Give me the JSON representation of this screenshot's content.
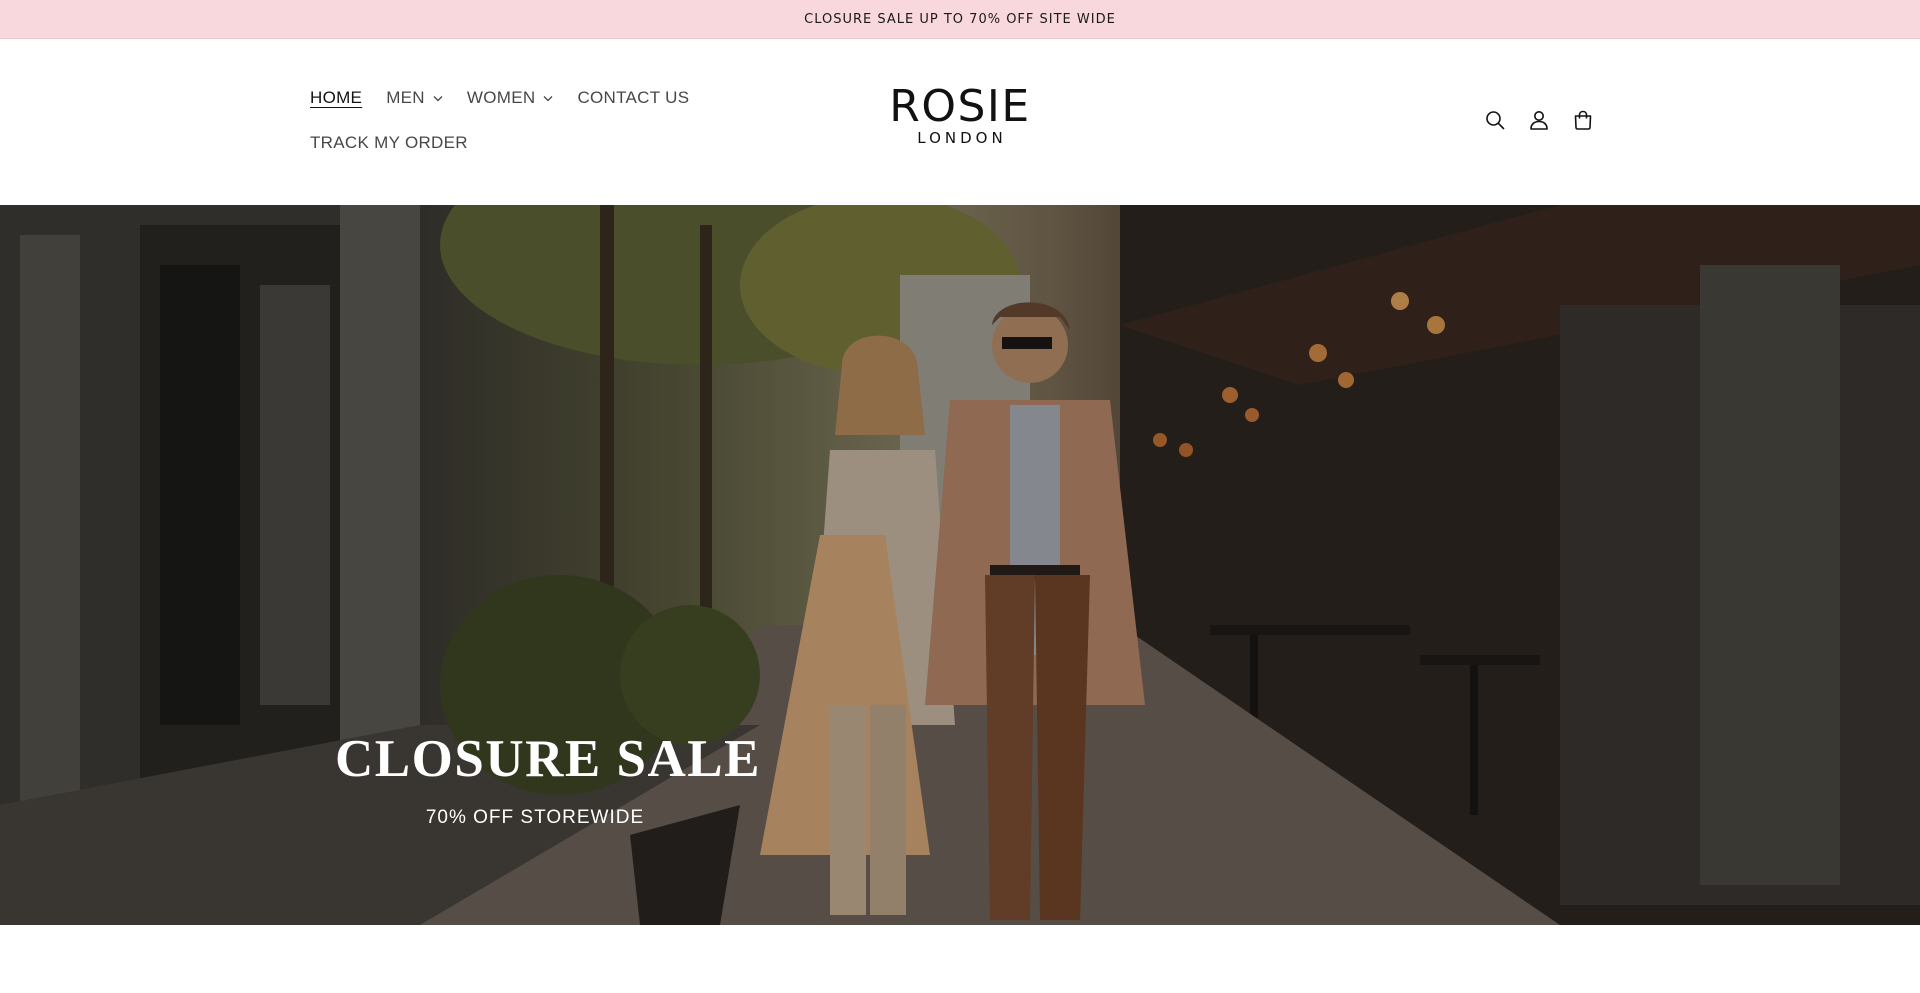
{
  "announcement": {
    "text": "CLOSURE SALE UP TO 70% OFF SITE WIDE"
  },
  "nav": {
    "items": [
      {
        "label": "HOME",
        "active": true,
        "has_dropdown": false
      },
      {
        "label": "MEN",
        "active": false,
        "has_dropdown": true
      },
      {
        "label": "WOMEN",
        "active": false,
        "has_dropdown": true
      },
      {
        "label": "CONTACT US",
        "active": false,
        "has_dropdown": false
      },
      {
        "label": "TRACK MY ORDER",
        "active": false,
        "has_dropdown": false
      }
    ]
  },
  "logo": {
    "main": "ROSIE",
    "sub": "LONDON"
  },
  "header_icons": [
    "search-icon",
    "account-icon",
    "cart-icon"
  ],
  "hero": {
    "title": "CLOSURE SALE",
    "subtitle": "70% OFF STOREWIDE",
    "image": "couple-walking-street-photo"
  },
  "colors": {
    "announcement_bg": "#f8d7dd",
    "text": "#121212",
    "hero_text": "#ffffff"
  }
}
